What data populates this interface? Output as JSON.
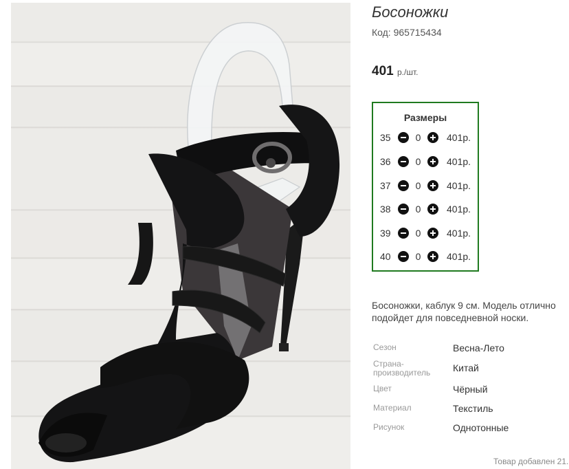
{
  "product": {
    "title": "Босоножки",
    "code": "Код: 965715434",
    "price": {
      "amount": "401",
      "unit": "р./шт."
    }
  },
  "sizes": {
    "title": "Размеры",
    "rows": [
      {
        "size": "35",
        "qty": "0",
        "price": "401р."
      },
      {
        "size": "36",
        "qty": "0",
        "price": "401р."
      },
      {
        "size": "37",
        "qty": "0",
        "price": "401р."
      },
      {
        "size": "38",
        "qty": "0",
        "price": "401р."
      },
      {
        "size": "39",
        "qty": "0",
        "price": "401р."
      },
      {
        "size": "40",
        "qty": "0",
        "price": "401р."
      }
    ]
  },
  "description": "Босоножки, каблук 9 см. Модель отлично подойдет для повседневной носки.",
  "attributes": [
    {
      "key": "Сезон",
      "value": "Весна-Лето"
    },
    {
      "key": "Страна-производитель",
      "value": "Китай"
    },
    {
      "key": "Цвет",
      "value": "Чёрный"
    },
    {
      "key": "Материал",
      "value": "Текстиль"
    },
    {
      "key": "Рисунок",
      "value": "Однотонные"
    }
  ],
  "added_text": "Товар добавлен 21.",
  "icons": {
    "minus": "minus-circle-icon",
    "plus": "plus-circle-icon"
  },
  "colors": {
    "sizes_border": "#1f7a1f",
    "button": "#111111"
  }
}
